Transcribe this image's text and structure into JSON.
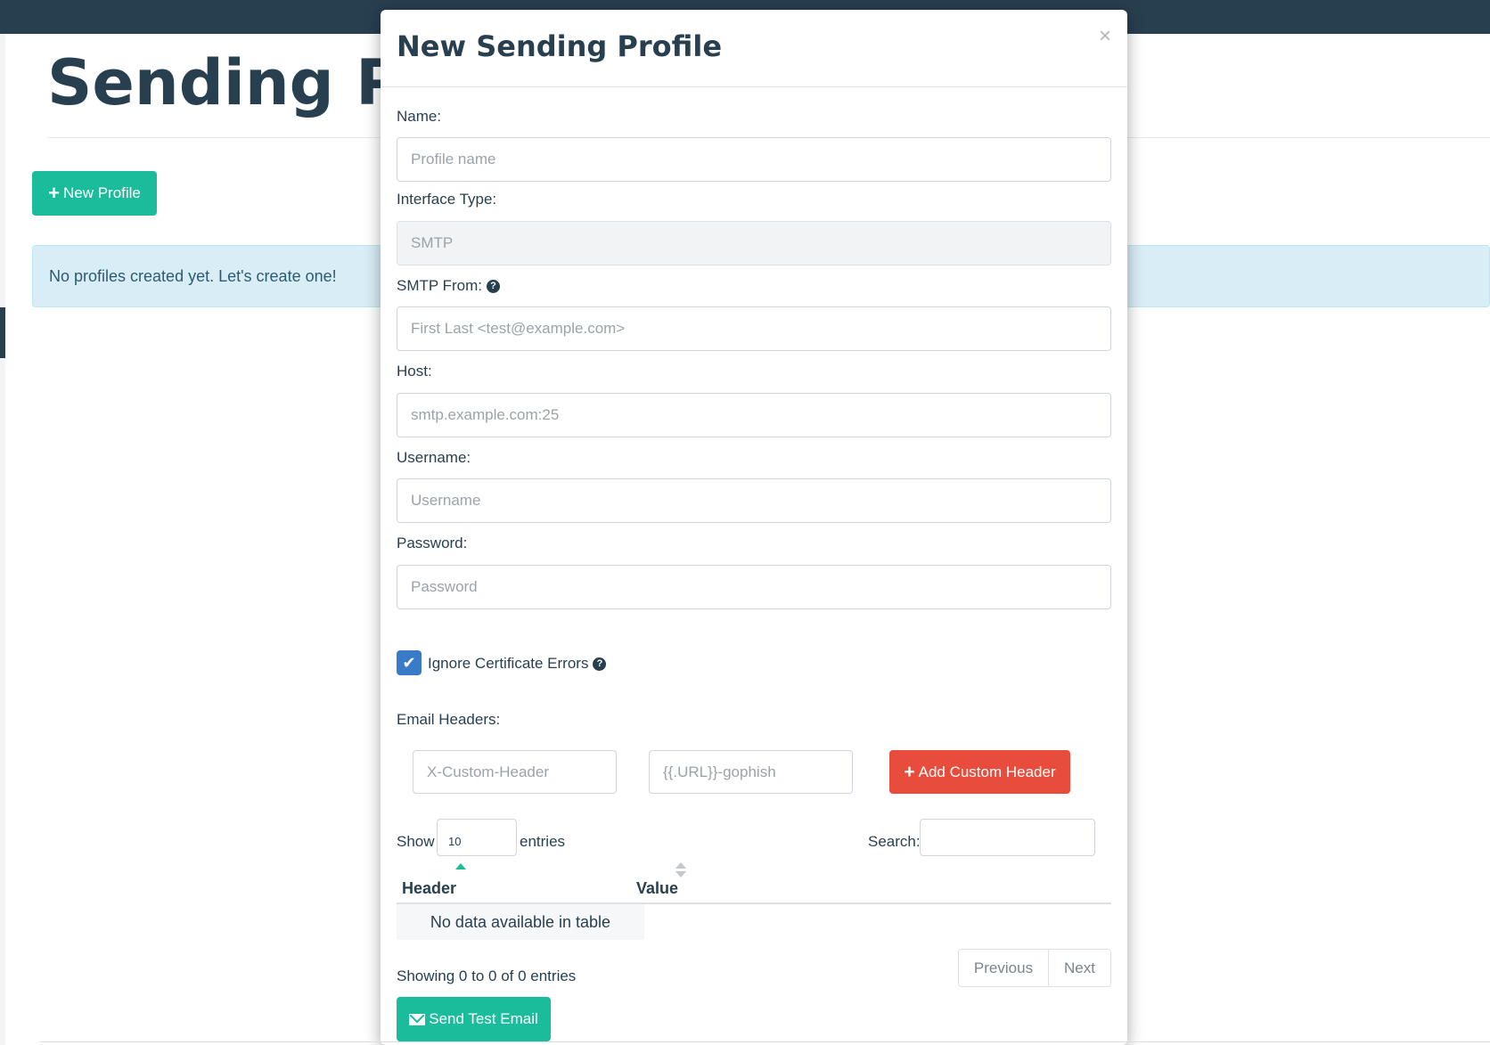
{
  "page": {
    "title": "Sending Pro",
    "new_profile_label": "New Profile",
    "empty_alert": "No profiles created yet. Let's create one!"
  },
  "modal": {
    "title": "New Sending Profile",
    "close": "×",
    "fields": {
      "name": {
        "label": "Name:",
        "placeholder": "Profile name"
      },
      "interface_type": {
        "label": "Interface Type:",
        "value": "SMTP"
      },
      "smtp_from": {
        "label": "SMTP From:",
        "placeholder": "First Last <test@example.com>"
      },
      "host": {
        "label": "Host:",
        "placeholder": "smtp.example.com:25"
      },
      "username": {
        "label": "Username:",
        "placeholder": "Username"
      },
      "password": {
        "label": "Password:",
        "placeholder": "Password"
      }
    },
    "ignore_cert": {
      "label": "Ignore Certificate Errors",
      "checked": true
    },
    "email_headers": {
      "label": "Email Headers:",
      "header_placeholder": "X-Custom-Header",
      "value_placeholder": "{{.URL}}-gophish",
      "add_button": "Add Custom Header"
    },
    "table": {
      "show_label": "Show",
      "entries_value": "10",
      "entries_label": "entries",
      "search_label": "Search:",
      "columns": [
        "Header",
        "Value"
      ],
      "empty_message": "No data available in table",
      "info": "Showing 0 to 0 of 0 entries",
      "previous": "Previous",
      "next": "Next"
    },
    "send_test_label": "Send Test Email"
  },
  "icons": {
    "plus": "+",
    "help": "?",
    "check": "✔",
    "close": "×"
  },
  "colors": {
    "navbar": "#283f50",
    "primary_green": "#1abc9c",
    "danger_red": "#e74c3c",
    "checkbox_blue": "#3a7bc8",
    "info_bg": "#d9edf7"
  }
}
